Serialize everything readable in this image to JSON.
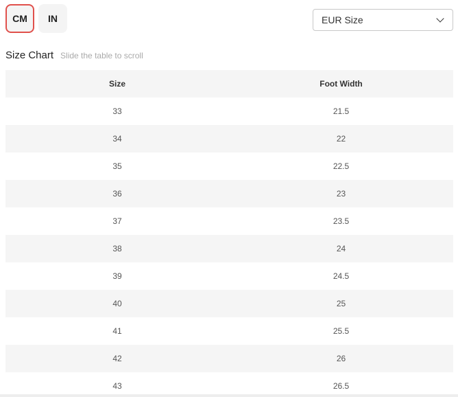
{
  "units": {
    "options": [
      "CM",
      "IN"
    ],
    "selected": "CM"
  },
  "size_system": {
    "selected": "EUR Size"
  },
  "chart": {
    "title": "Size Chart",
    "hint": "Slide the table to scroll",
    "columns": [
      "Size",
      "Foot Width"
    ],
    "rows": [
      [
        "33",
        "21.5"
      ],
      [
        "34",
        "22"
      ],
      [
        "35",
        "22.5"
      ],
      [
        "36",
        "23"
      ],
      [
        "37",
        "23.5"
      ],
      [
        "38",
        "24"
      ],
      [
        "39",
        "24.5"
      ],
      [
        "40",
        "25"
      ],
      [
        "41",
        "25.5"
      ],
      [
        "42",
        "26"
      ],
      [
        "43",
        "26.5"
      ]
    ]
  },
  "colors": {
    "active_border": "#e0504b",
    "stripe": "#f5f5f5"
  }
}
